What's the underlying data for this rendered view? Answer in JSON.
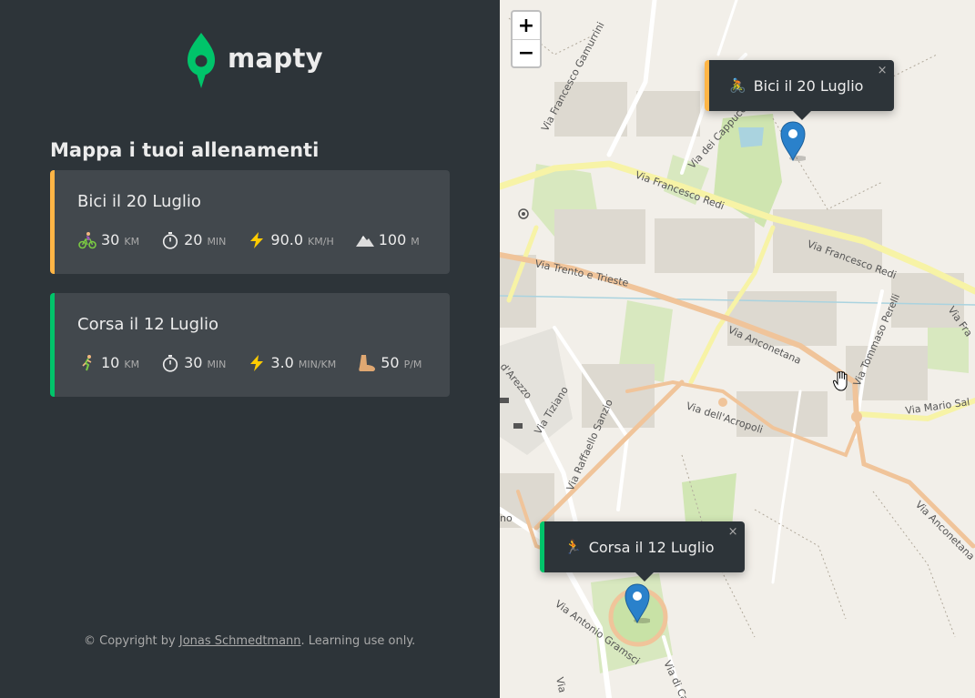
{
  "app": {
    "name": "mapty",
    "heading": "Mappa i tuoi allenamenti",
    "accent_cycling": "#ffb545",
    "accent_running": "#00c46a"
  },
  "workouts": [
    {
      "type": "cycling",
      "title": "Bici il 20 Luglio",
      "details": [
        {
          "icon": "cyclist-icon",
          "glyph": "🚴",
          "value": "30",
          "unit": "km"
        },
        {
          "icon": "stopwatch-icon",
          "glyph": "⏱",
          "value": "20",
          "unit": "min"
        },
        {
          "icon": "lightning-icon",
          "glyph": "⚡",
          "value": "90.0",
          "unit": "km/h"
        },
        {
          "icon": "mountain-icon",
          "glyph": "⛰",
          "value": "100",
          "unit": "m"
        }
      ]
    },
    {
      "type": "running",
      "title": "Corsa il 12 Luglio",
      "details": [
        {
          "icon": "runner-icon",
          "glyph": "🏃",
          "value": "10",
          "unit": "km"
        },
        {
          "icon": "stopwatch-icon",
          "glyph": "⏱",
          "value": "30",
          "unit": "min"
        },
        {
          "icon": "lightning-icon",
          "glyph": "⚡",
          "value": "3.0",
          "unit": "min/km"
        },
        {
          "icon": "foot-icon",
          "glyph": "🦶",
          "value": "50",
          "unit": "p/m"
        }
      ]
    }
  ],
  "copyright": {
    "prefix": "© Copyright by ",
    "author": "Jonas Schmedtmann",
    "suffix": ". Learning use only."
  },
  "map": {
    "zoom_in": "+",
    "zoom_out": "−",
    "popups": [
      {
        "type": "cycling",
        "label": "Bici il 20 Luglio",
        "close": "×"
      },
      {
        "type": "running",
        "label": "Corsa il 12 Luglio",
        "close": "×"
      }
    ],
    "streets": [
      "Via Francesco Gamurrini",
      "Via dei Cappuccini",
      "Via Francesco Redi",
      "Via Francesco Redi",
      "Via Trento e Trieste",
      "Via Anconetana",
      "Via Tommaso Perelli",
      "Via Fra",
      "Via Mario Sal",
      "d'Arezzo",
      "Via Tiziano",
      "Via Raffaello Sanzio",
      "Via dell'Acropoli",
      "Via Anconetana",
      "Via Antonio Gramsci",
      "Via di Ca",
      "Via",
      "no"
    ]
  }
}
